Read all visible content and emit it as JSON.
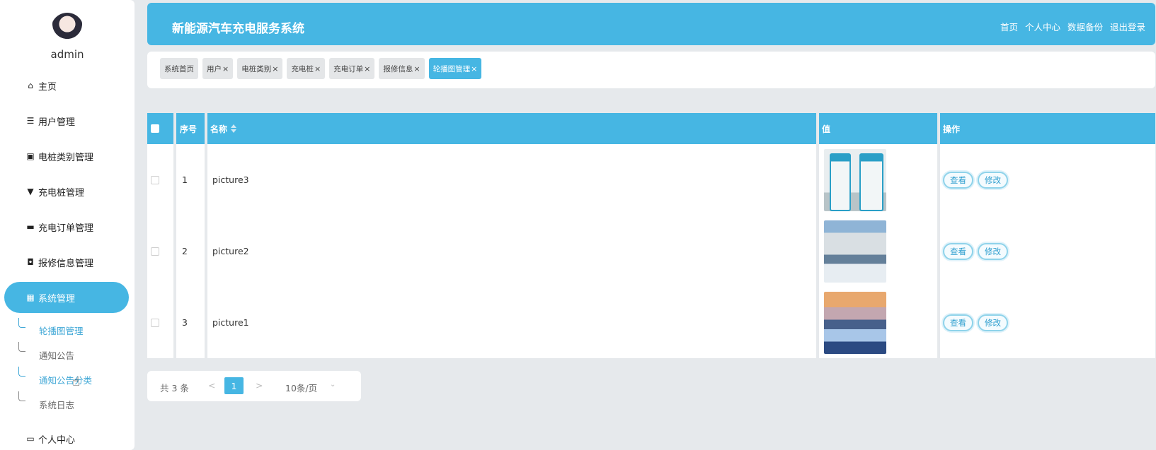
{
  "header": {
    "title": "新能源汽车充电服务系统",
    "nav": [
      "首页",
      "个人中心",
      "数据备份",
      "退出登录"
    ]
  },
  "sidebar": {
    "username": "admin",
    "items": [
      {
        "label": "主页",
        "icon": "home-icon"
      },
      {
        "label": "用户管理",
        "icon": "list-icon"
      },
      {
        "label": "电桩类别管理",
        "icon": "clipboard-icon"
      },
      {
        "label": "充电桩管理",
        "icon": "charger-icon"
      },
      {
        "label": "充电订单管理",
        "icon": "monitor-icon"
      },
      {
        "label": "报修信息管理",
        "icon": "briefcase-icon"
      },
      {
        "label": "系统管理",
        "icon": "grid-icon",
        "active": true
      },
      {
        "label": "个人中心",
        "icon": "card-icon"
      }
    ],
    "subitems": [
      "轮播图管理",
      "通知公告",
      "通知公告分类",
      "系统日志"
    ]
  },
  "tags": [
    {
      "label": "系统首页"
    },
    {
      "label": "用户",
      "close": "×"
    },
    {
      "label": "电桩类别",
      "close": "×"
    },
    {
      "label": "充电桩",
      "close": "×"
    },
    {
      "label": "充电订单",
      "close": "×"
    },
    {
      "label": "报修信息",
      "close": "×"
    },
    {
      "label": "轮播图管理",
      "close": "×",
      "active": true
    }
  ],
  "table": {
    "headers": {
      "index": "序号",
      "name": "名称",
      "value": "值",
      "actions": "操作"
    },
    "rows": [
      {
        "index": "1",
        "name": "picture3"
      },
      {
        "index": "2",
        "name": "picture2"
      },
      {
        "index": "3",
        "name": "picture1"
      }
    ],
    "view_label": "查看",
    "edit_label": "修改"
  },
  "pagination": {
    "total": "共 3 条",
    "prev": "<",
    "current": "1",
    "next": ">",
    "page_size": "10条/页",
    "size_arrow": "⌄"
  },
  "colors": {
    "accent": "#46b6e3"
  }
}
